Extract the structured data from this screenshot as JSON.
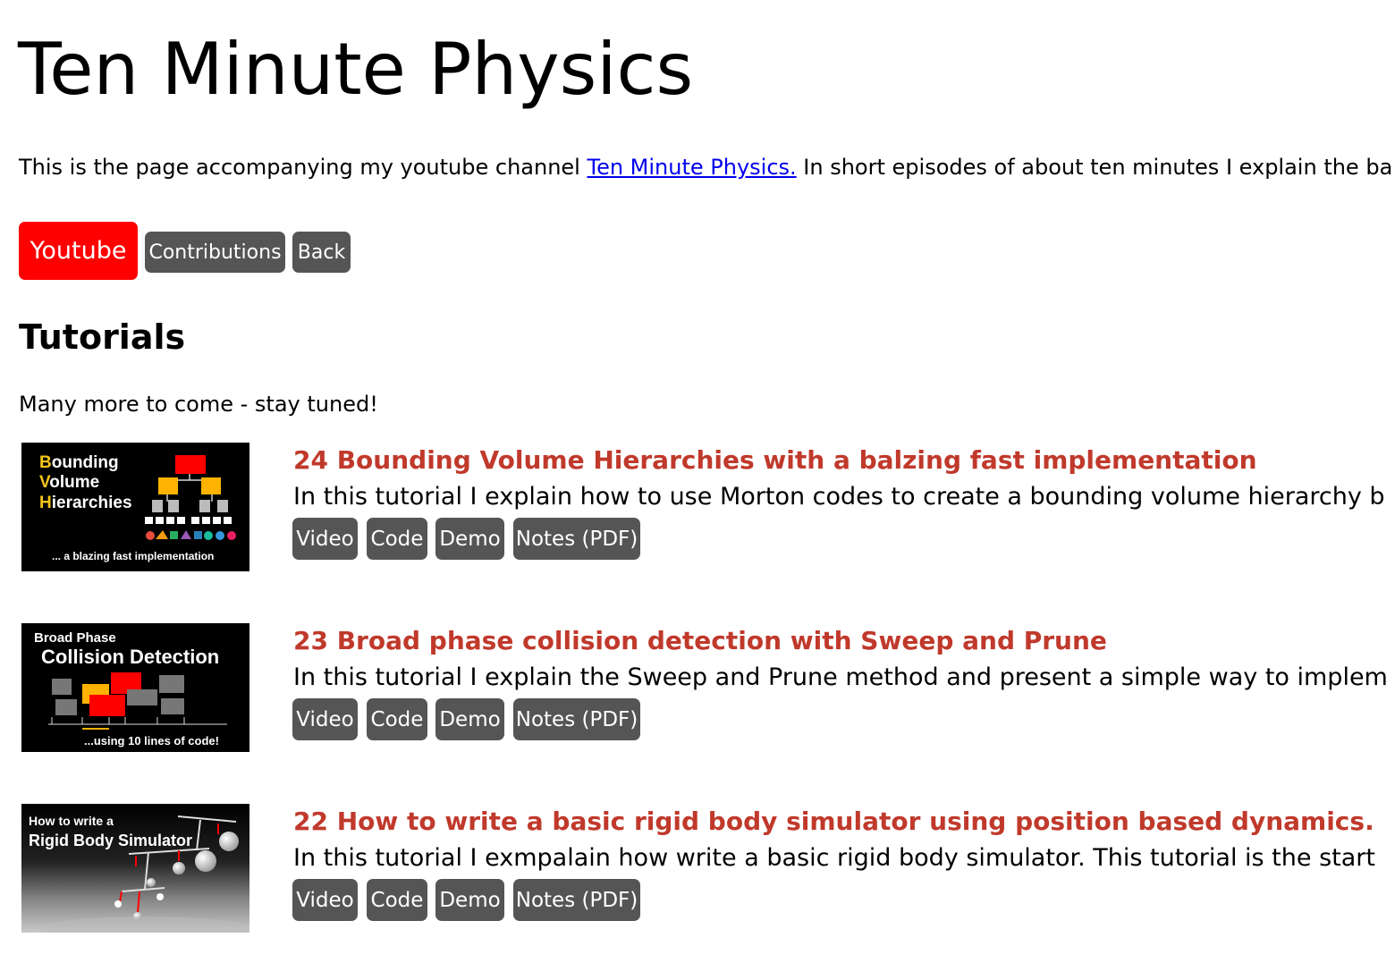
{
  "header": {
    "title": "Ten Minute Physics"
  },
  "intro": {
    "before_link": "This is the page accompanying my youtube channel ",
    "link_text": "Ten Minute Physics.",
    "after_link": " In short episodes of about ten minutes I explain the ba"
  },
  "nav": {
    "youtube": "Youtube",
    "contributions": "Contributions",
    "back": "Back"
  },
  "colors": {
    "accent_red": "#ff0000",
    "title_red": "#c0392b",
    "button_gray": "#555555"
  },
  "tutorials_section": {
    "heading": "Tutorials",
    "subtitle": "Many more to come - stay tuned!"
  },
  "tutorials": [
    {
      "title": "24 Bounding Volume Hierarchies with a balzing fast implementation",
      "description": "In this tutorial I explain how to use Morton codes to create a bounding volume hierarchy b",
      "thumb": {
        "line1_initial": "B",
        "line1_rest": "ounding",
        "line2_initial": "V",
        "line2_rest": "olume",
        "line3_initial": "H",
        "line3_rest": "ierarchies",
        "footer": "... a blazing fast implementation"
      },
      "buttons": {
        "video": "Video",
        "code": "Code",
        "demo": "Demo",
        "notes": "Notes (PDF)"
      }
    },
    {
      "title": "23 Broad phase collision detection with Sweep and Prune",
      "description": "In this tutorial I explain the Sweep and Prune method and present a simple way to implem",
      "thumb": {
        "line1": "Broad Phase",
        "line2": "Collision Detection",
        "footer": "...using 10 lines of code!"
      },
      "buttons": {
        "video": "Video",
        "code": "Code",
        "demo": "Demo",
        "notes": "Notes (PDF)"
      }
    },
    {
      "title": "22 How to write a basic rigid body simulator using position based dynamics.",
      "description": "In this tutorial I exmpalain how write a basic rigid body simulator. This tutorial is the start",
      "thumb": {
        "line1": "How to write a",
        "line2": "Rigid Body Simulator"
      },
      "buttons": {
        "video": "Video",
        "code": "Code",
        "demo": "Demo",
        "notes": "Notes (PDF)"
      }
    }
  ]
}
